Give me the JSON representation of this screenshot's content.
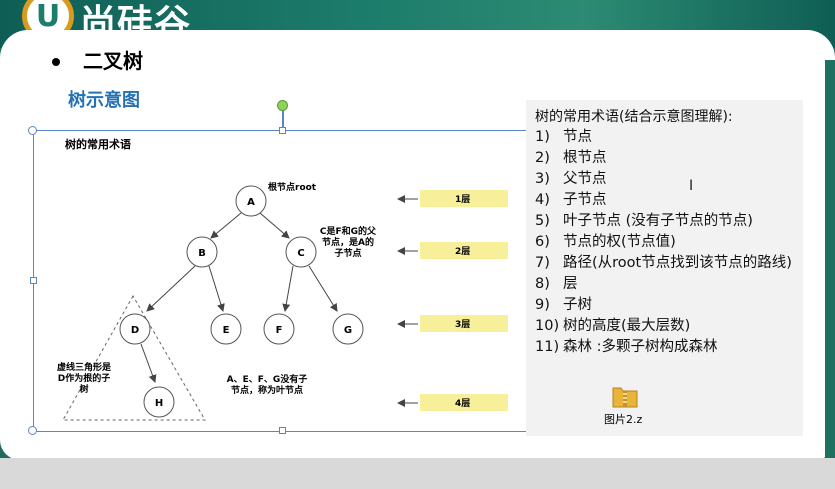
{
  "brand": {
    "logo_letter": "U",
    "logo_text": "尚硅谷"
  },
  "slide": {
    "heading": "二叉树",
    "subheading": "树示意图",
    "diagram": {
      "title": "树的常用术语",
      "nodes": [
        "A",
        "B",
        "C",
        "D",
        "E",
        "F",
        "G",
        "H"
      ],
      "root_label": "根节点root",
      "parent_note": [
        "C是F和G的父",
        "节点，是A的",
        "子节点"
      ],
      "leaf_note": [
        "A、E、F、G没有子",
        "节点，称为叶节点"
      ],
      "triangle_note": [
        "虚线三角形是",
        "D作为根的子",
        "树"
      ],
      "levels": [
        "1层",
        "2层",
        "3层",
        "4层"
      ]
    },
    "terms": {
      "title": "树的常用术语(结合示意图理解):",
      "items": [
        {
          "num": "1)",
          "text": "节点"
        },
        {
          "num": "2)",
          "text": "根节点"
        },
        {
          "num": "3)",
          "text": "父节点"
        },
        {
          "num": "4)",
          "text": "子节点"
        },
        {
          "num": "5)",
          "text": "叶子节点 (没有子节点的节点)"
        },
        {
          "num": "6)",
          "text": "节点的权(节点值)"
        },
        {
          "num": "7)",
          "text": "路径(从root节点找到该节点的路线)"
        },
        {
          "num": "8)",
          "text": "层"
        },
        {
          "num": "9)",
          "text": "子树"
        },
        {
          "num": "10)",
          "text": "树的高度(最大层数)"
        },
        {
          "num": "11)",
          "text": "森林 :多颗子树构成森林"
        }
      ]
    },
    "attachment": {
      "name": "图片2.z",
      "icon": "folder-zip-icon"
    }
  }
}
